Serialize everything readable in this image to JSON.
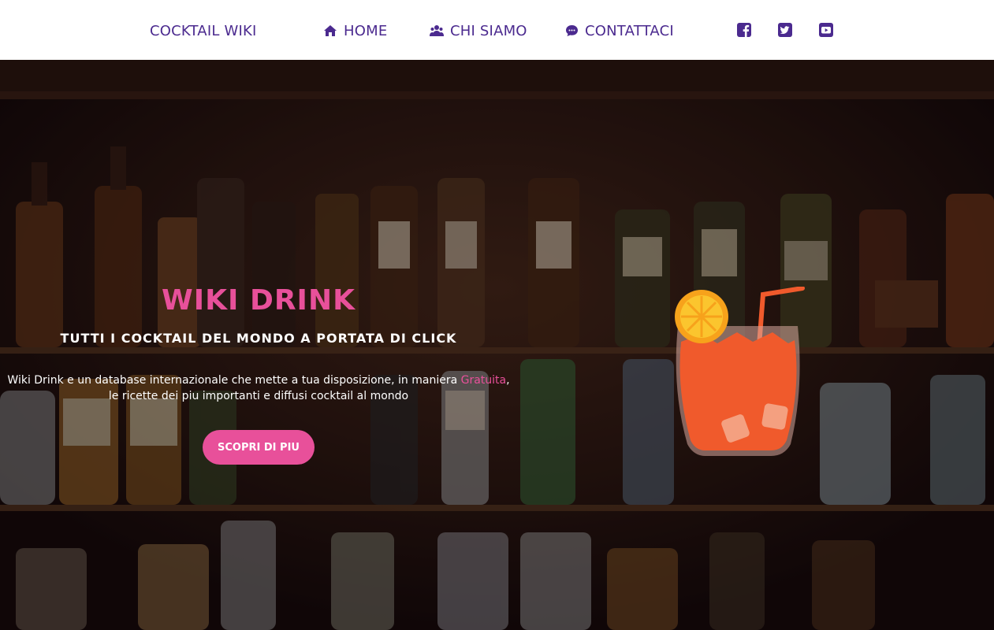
{
  "nav": {
    "brand": "COCKTAIL WIKI",
    "links": [
      {
        "label": "HOME",
        "icon": "home-icon"
      },
      {
        "label": "CHI SIAMO",
        "icon": "users-icon"
      },
      {
        "label": "CONTATTACI",
        "icon": "chat-icon"
      }
    ],
    "social": [
      "facebook-icon",
      "twitter-icon",
      "youtube-icon"
    ]
  },
  "hero": {
    "title": "WIKI DRINK",
    "subtitle": "TUTTI I COCKTAIL DEL MONDO A PORTATA DI CLICK",
    "description_before": "Wiki Drink e un database internazionale che mette a tua disposizione, in maniera ",
    "description_highlight": "Gratuita",
    "description_after": ",",
    "description_line2": "le ricette dei piu importanti e diffusi cocktail al mondo",
    "cta": "SCOPRI DI PIU"
  },
  "colors": {
    "accent": "#e8509a",
    "nav_text": "#4b2a8f",
    "nav_bg": "#ffffff",
    "drink": "#f05a2c",
    "orange_slice": "#f7a21b"
  }
}
